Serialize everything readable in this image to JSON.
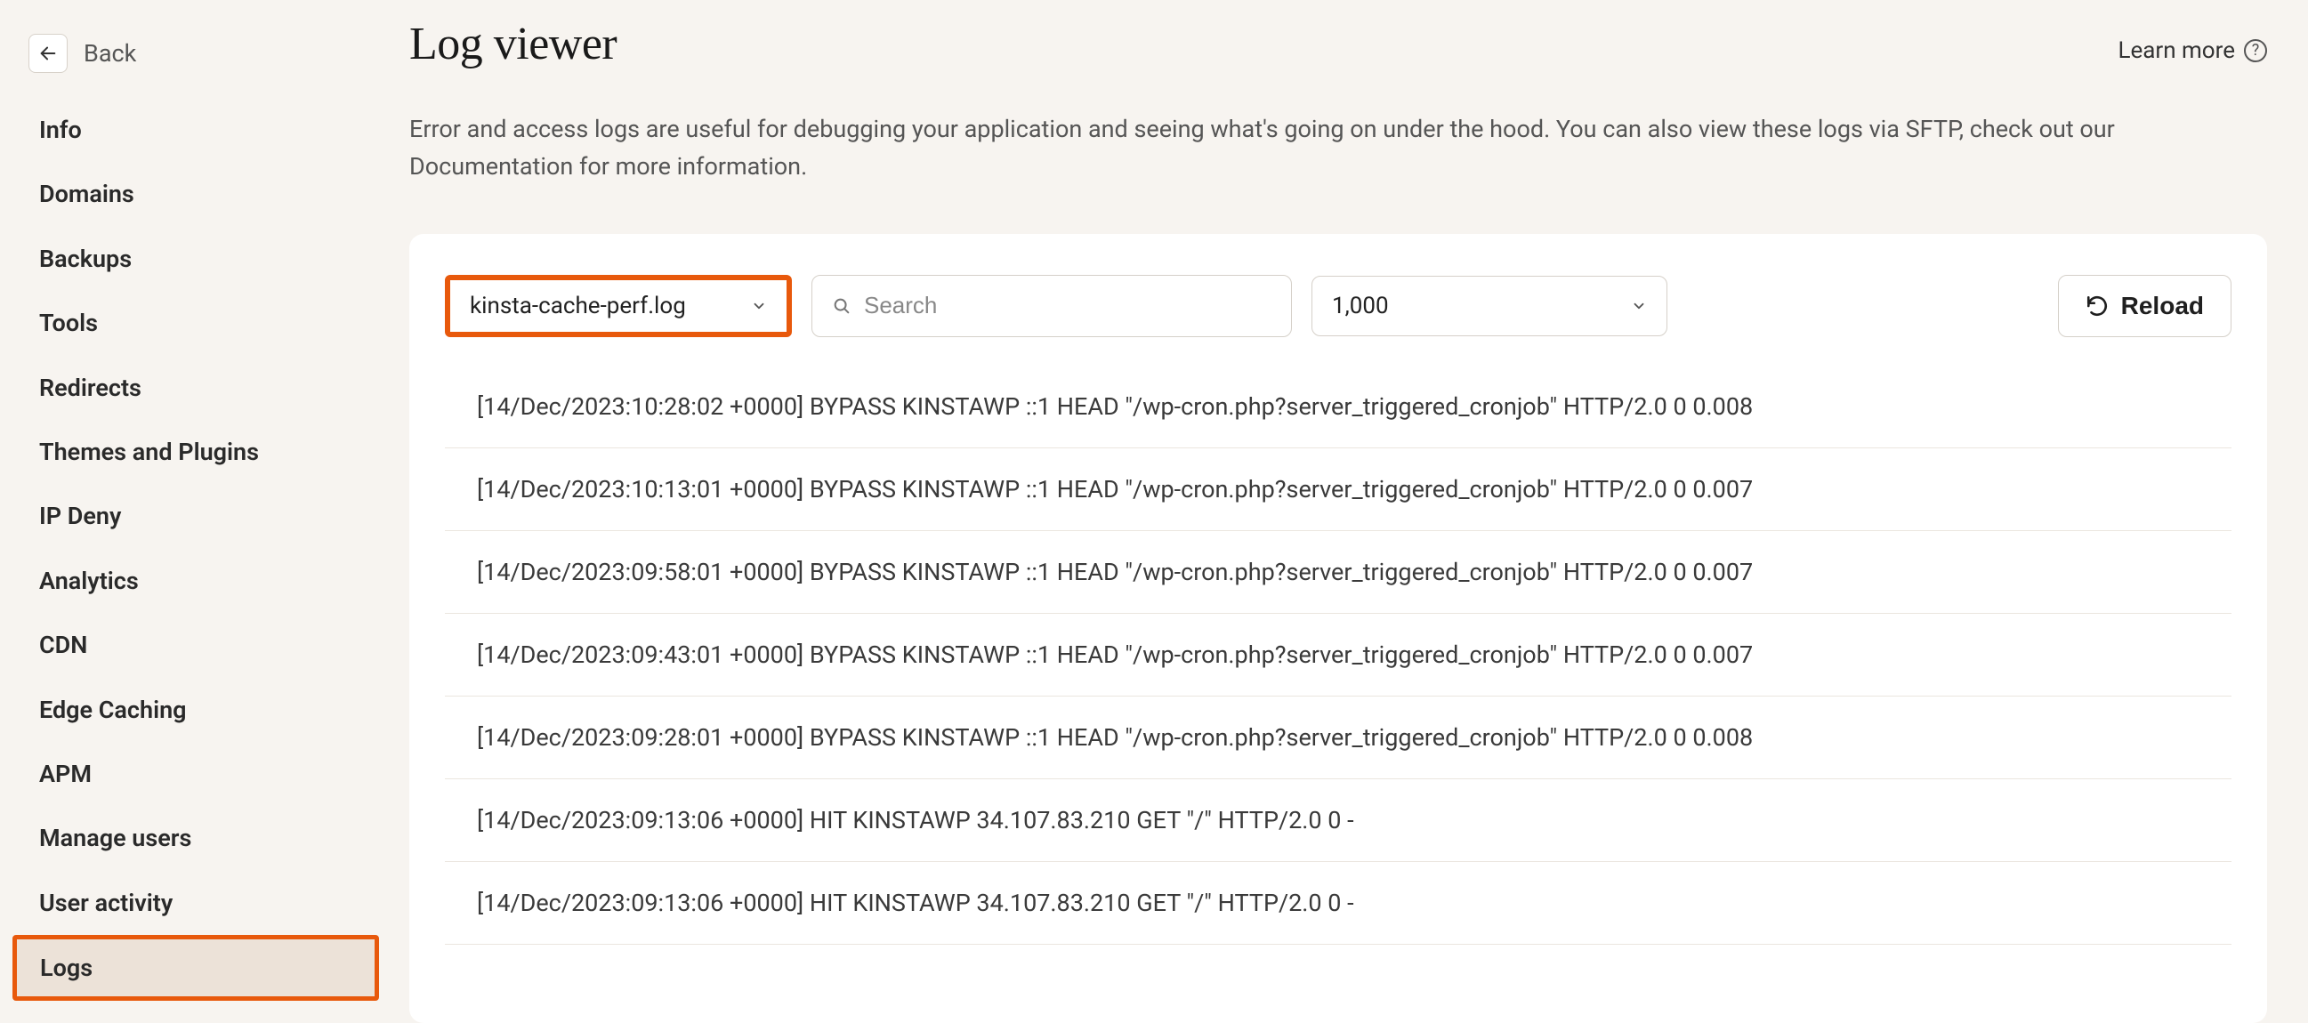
{
  "sidebar": {
    "back_label": "Back",
    "items": [
      {
        "label": "Info"
      },
      {
        "label": "Domains"
      },
      {
        "label": "Backups"
      },
      {
        "label": "Tools"
      },
      {
        "label": "Redirects"
      },
      {
        "label": "Themes and Plugins"
      },
      {
        "label": "IP Deny"
      },
      {
        "label": "Analytics"
      },
      {
        "label": "CDN"
      },
      {
        "label": "Edge Caching"
      },
      {
        "label": "APM"
      },
      {
        "label": "Manage users"
      },
      {
        "label": "User activity"
      },
      {
        "label": "Logs",
        "active": true
      }
    ]
  },
  "header": {
    "title": "Log viewer",
    "learn_more": "Learn more"
  },
  "description": "Error and access logs are useful for debugging your application and seeing what's going on under the hood. You can also view these logs via SFTP, check out our Documentation for more information.",
  "controls": {
    "file_selected": "kinsta-cache-perf.log",
    "search_placeholder": "Search",
    "count_selected": "1,000",
    "reload_label": "Reload"
  },
  "logs": [
    "[14/Dec/2023:10:28:02 +0000] BYPASS KINSTAWP ::1 HEAD \"/wp-cron.php?server_triggered_cronjob\" HTTP/2.0 0 0.008",
    "[14/Dec/2023:10:13:01 +0000] BYPASS KINSTAWP ::1 HEAD \"/wp-cron.php?server_triggered_cronjob\" HTTP/2.0 0 0.007",
    "[14/Dec/2023:09:58:01 +0000] BYPASS KINSTAWP ::1 HEAD \"/wp-cron.php?server_triggered_cronjob\" HTTP/2.0 0 0.007",
    "[14/Dec/2023:09:43:01 +0000] BYPASS KINSTAWP ::1 HEAD \"/wp-cron.php?server_triggered_cronjob\" HTTP/2.0 0 0.007",
    "[14/Dec/2023:09:28:01 +0000] BYPASS KINSTAWP ::1 HEAD \"/wp-cron.php?server_triggered_cronjob\" HTTP/2.0 0 0.008",
    "[14/Dec/2023:09:13:06 +0000] HIT KINSTAWP 34.107.83.210 GET \"/\" HTTP/2.0 0 -",
    "[14/Dec/2023:09:13:06 +0000] HIT KINSTAWP 34.107.83.210 GET \"/\" HTTP/2.0 0 -"
  ]
}
